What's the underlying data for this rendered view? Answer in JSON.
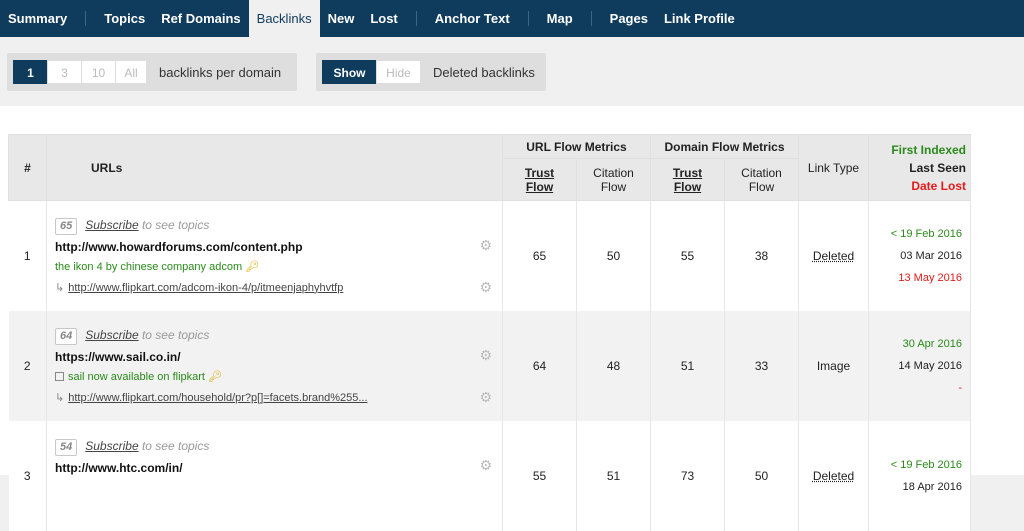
{
  "nav": {
    "items": [
      "Summary",
      "Topics",
      "Ref Domains",
      "Backlinks",
      "New",
      "Lost",
      "Anchor Text",
      "Map",
      "Pages",
      "Link Profile"
    ],
    "active": "Backlinks"
  },
  "controls": {
    "per_domain": {
      "options": [
        "1",
        "3",
        "10",
        "All"
      ],
      "selected": "1",
      "label": "backlinks per domain"
    },
    "deleted": {
      "options": [
        "Show",
        "Hide"
      ],
      "selected": "Show",
      "label": "Deleted backlinks"
    }
  },
  "table": {
    "headers": {
      "num": "#",
      "urls": "URLs",
      "url_flow": "URL Flow Metrics",
      "domain_flow": "Domain Flow Metrics",
      "trust_flow": "Trust Flow",
      "citation_flow": "Citation Flow",
      "link_type": "Link Type",
      "first_indexed": "First Indexed",
      "last_seen": "Last Seen",
      "date_lost": "Date Lost"
    },
    "rows": [
      {
        "num": "1",
        "topic_score": "65",
        "subscribe": "Subscribe",
        "subscribe_rest": "to see topics",
        "url": "http://www.howardforums.com/content.php",
        "anchor": "the ikon 4 by chinese company adcom",
        "target": "http://www.flipkart.com/adcom-ikon-4/p/itmeenjaphyhvtfp",
        "url_tf": "65",
        "url_cf": "50",
        "dom_tf": "55",
        "dom_cf": "38",
        "type": "Deleted",
        "first": "< 19 Feb 2016",
        "last": "03 Mar 2016",
        "lost": "13 May 2016"
      },
      {
        "num": "2",
        "topic_score": "64",
        "subscribe": "Subscribe",
        "subscribe_rest": "to see topics",
        "url": "https://www.sail.co.in/",
        "anchor": "sail now available on flipkart",
        "target": "http://www.flipkart.com/household/pr?p[]=facets.brand%255...",
        "url_tf": "64",
        "url_cf": "48",
        "dom_tf": "51",
        "dom_cf": "33",
        "type": "Image",
        "first": "30 Apr 2016",
        "last": "14 May 2016",
        "lost": "-"
      },
      {
        "num": "3",
        "topic_score": "54",
        "subscribe": "Subscribe",
        "subscribe_rest": "to see topics",
        "url": "http://www.htc.com/in/",
        "url_tf": "55",
        "url_cf": "51",
        "dom_tf": "73",
        "dom_cf": "50",
        "type": "Deleted",
        "first": "< 19 Feb 2016",
        "last": "18 Apr 2016"
      }
    ]
  },
  "colors": {
    "nav_bg": "#0f3b5c",
    "first_indexed": "#2a8a1a",
    "date_lost": "#e01b1b"
  }
}
